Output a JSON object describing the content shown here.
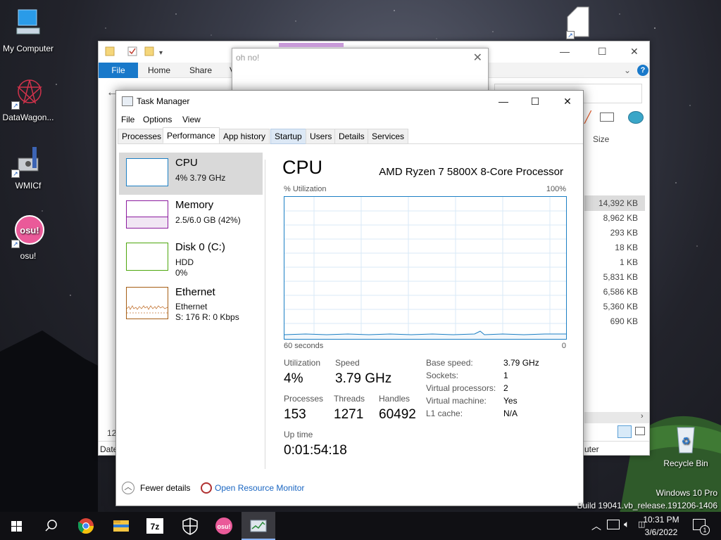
{
  "desktop": {
    "icons": [
      {
        "label": "My Computer"
      },
      {
        "label": "DataWagon..."
      },
      {
        "label": "WMICf"
      },
      {
        "label": "osu!"
      },
      {
        "label": "Recycle Bin"
      }
    ],
    "watermark": {
      "line1": "Windows 10 Pro",
      "line2": "Build 19041.vb_release.191206-1406"
    }
  },
  "explorer": {
    "tabs": {
      "file": "File",
      "home": "Home",
      "share": "Share",
      "view": "V"
    },
    "column_size": "Size",
    "sizes": [
      "14,392 KB",
      "8,962 KB",
      "293 KB",
      "18 KB",
      "1 KB",
      "5,831 KB",
      "6,586 KB",
      "5,360 KB",
      "690 KB"
    ],
    "status_left": "12",
    "col_date": "Date",
    "col_computer": "uter"
  },
  "dialog": {
    "title": "oh no!",
    "close": "✕"
  },
  "task_manager": {
    "title": "Task Manager",
    "window_controls": {
      "minimize": "—",
      "maximize": "☐",
      "close": "✕"
    },
    "menu": {
      "file": "File",
      "options": "Options",
      "view": "View"
    },
    "tabs": [
      "Processes",
      "Performance",
      "App history",
      "Startup",
      "Users",
      "Details",
      "Services"
    ],
    "resources": {
      "cpu": {
        "name": "CPU",
        "sub": "4%  3.79 GHz"
      },
      "memory": {
        "name": "Memory",
        "sub": "2.5/6.0 GB (42%)"
      },
      "disk": {
        "name": "Disk 0 (C:)",
        "sub1": "HDD",
        "sub2": "0%"
      },
      "ethernet": {
        "name": "Ethernet",
        "sub1": "Ethernet",
        "sub2": "S: 176  R: 0 Kbps"
      }
    },
    "cpu": {
      "heading": "CPU",
      "model": "AMD Ryzen 7 5800X 8-Core Processor",
      "util_label": "% Utilization",
      "util_max": "100%",
      "time_label": "60 seconds",
      "time_min": "0",
      "utilization_label": "Utilization",
      "utilization": "4%",
      "speed_label": "Speed",
      "speed": "3.79 GHz",
      "processes_label": "Processes",
      "processes": "153",
      "threads_label": "Threads",
      "threads": "1271",
      "handles_label": "Handles",
      "handles": "60492",
      "uptime_label": "Up time",
      "uptime": "0:01:54:18",
      "details": [
        {
          "label": "Base speed:",
          "value": "3.79 GHz"
        },
        {
          "label": "Sockets:",
          "value": "1"
        },
        {
          "label": "Virtual processors:",
          "value": "2"
        },
        {
          "label": "Virtual machine:",
          "value": "Yes"
        },
        {
          "label": "L1 cache:",
          "value": "N/A"
        }
      ]
    },
    "footer": {
      "fewer_details": "Fewer details",
      "resource_monitor": "Open Resource Monitor"
    }
  },
  "taskbar": {
    "time": "10:31 PM",
    "date": "3/6/2022",
    "notification_count": "1",
    "apps": [
      "start-icon",
      "search-icon",
      "chrome-icon",
      "file-explorer-icon",
      "7zip-icon",
      "security-icon",
      "osu-icon",
      "task-manager-icon"
    ]
  }
}
